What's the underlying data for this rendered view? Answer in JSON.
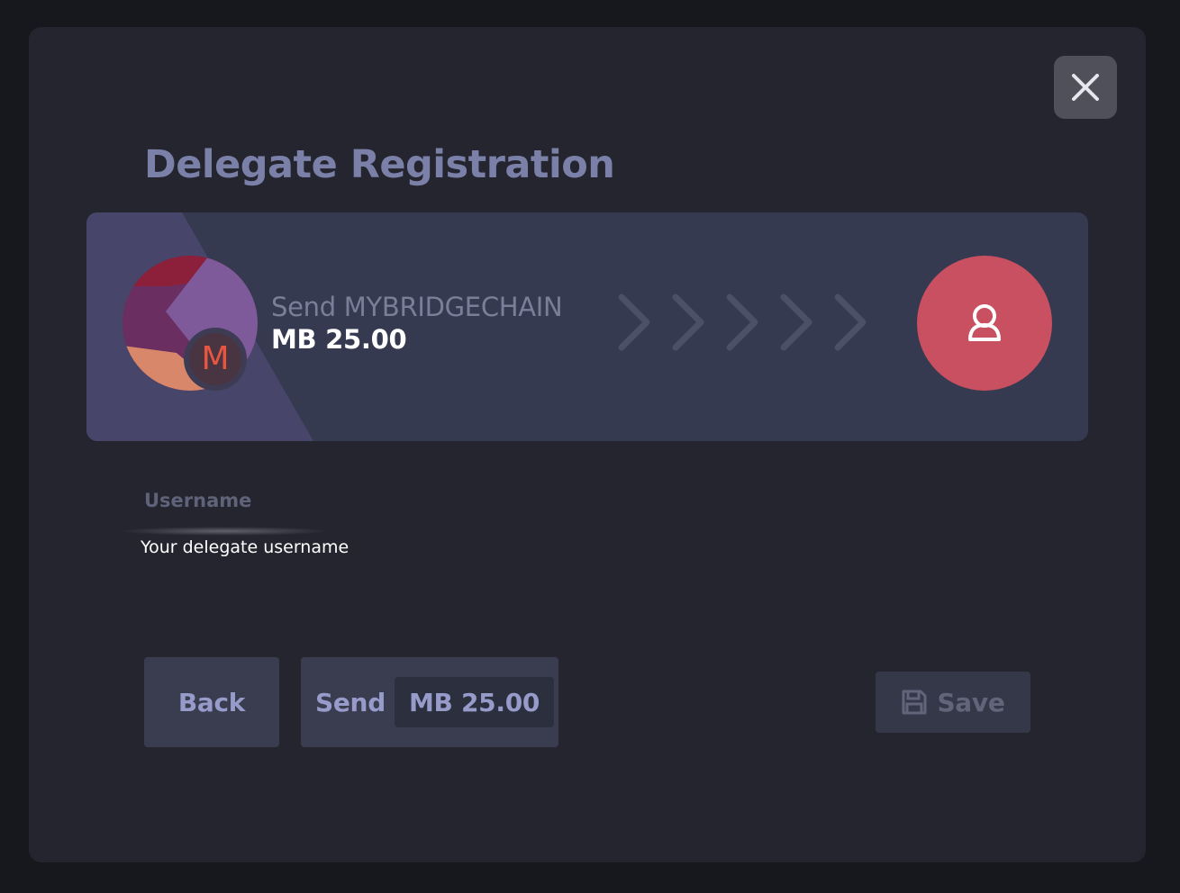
{
  "modal": {
    "title": "Delegate Registration",
    "close_icon": "close-icon"
  },
  "transaction": {
    "send_label": "Send MYBRIDGECHAIN",
    "amount": "MB 25.00",
    "token_badge_letter": "M",
    "recipient_icon": "user-icon",
    "colors": {
      "recipient_bg": "#c85060",
      "token_letter": "#e8563f"
    }
  },
  "form": {
    "username_label": "Username",
    "username_placeholder": "Your delegate username",
    "username_value": ""
  },
  "actions": {
    "back_label": "Back",
    "send_label": "Send",
    "send_amount": "MB 25.00",
    "save_label": "Save",
    "save_icon": "save-icon"
  }
}
